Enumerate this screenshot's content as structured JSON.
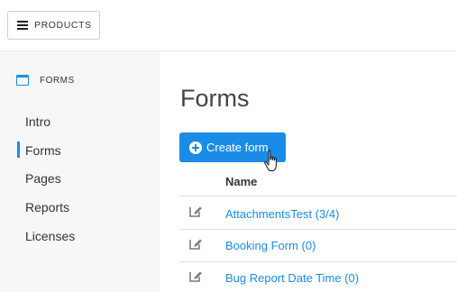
{
  "topbar": {
    "products_label": "PRODUCTS"
  },
  "sidebar": {
    "section_title": "FORMS",
    "items": [
      {
        "label": "Intro",
        "active": false
      },
      {
        "label": "Forms",
        "active": true
      },
      {
        "label": "Pages",
        "active": false
      },
      {
        "label": "Reports",
        "active": false
      },
      {
        "label": "Licenses",
        "active": false
      }
    ]
  },
  "main": {
    "title": "Forms",
    "create_button_label": "Create form",
    "table": {
      "columns": [
        "Name"
      ],
      "rows": [
        {
          "name": "AttachmentsTest (3/4)"
        },
        {
          "name": "Booking Form (0)"
        },
        {
          "name": "Bug Report Date Time (0)"
        }
      ]
    }
  },
  "colors": {
    "accent": "#1a8ce6",
    "sidebar_bg": "#f7f7f7",
    "border": "#dedede"
  },
  "icons": {
    "menu": "hamburger-icon",
    "section": "window-icon",
    "create": "plus-circle-icon",
    "edit": "edit-icon",
    "cursor": "hand-pointer-icon"
  }
}
